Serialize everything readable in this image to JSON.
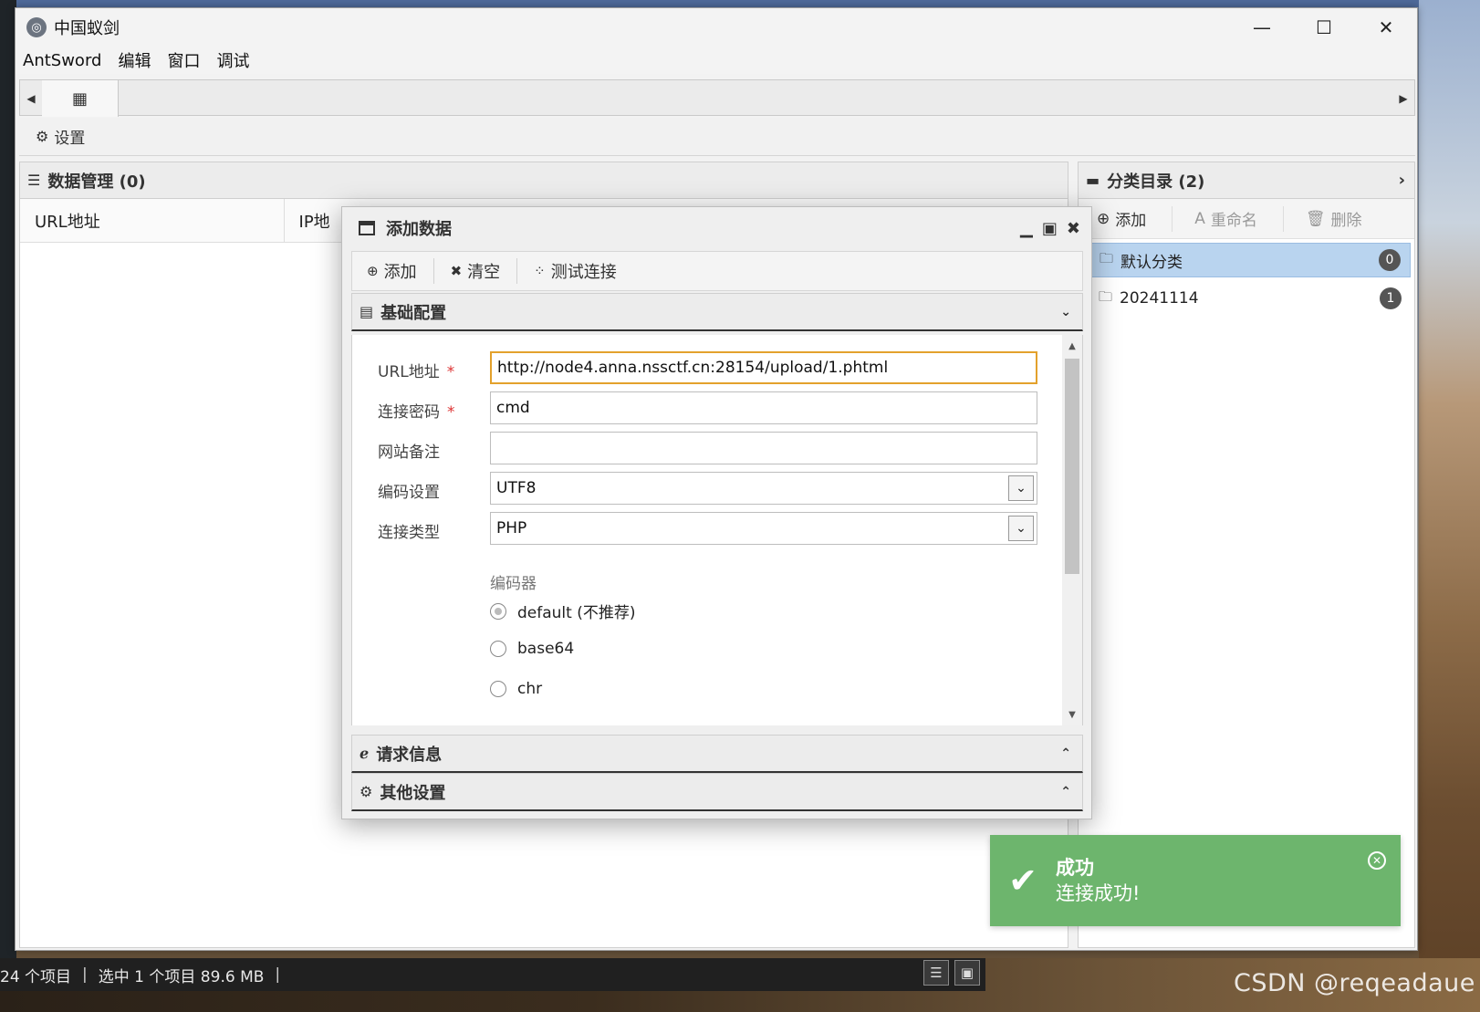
{
  "window": {
    "title": "中国蚁剑",
    "minimize": "—",
    "maximize": "☐",
    "close": "✕"
  },
  "menu": [
    "AntSword",
    "编辑",
    "窗口",
    "调试"
  ],
  "tabs": {
    "left_arrow": "◀",
    "right_arrow": "▶",
    "home_icon": "▦"
  },
  "settings_toolbar": {
    "label": "设置"
  },
  "data_panel": {
    "header": "数据管理 (0)",
    "columns": [
      "URL地址",
      "IP地"
    ]
  },
  "category_panel": {
    "header": "分类目录 (2)",
    "buttons": {
      "add": "添加",
      "rename": "重命名",
      "delete": "删除"
    },
    "items": [
      {
        "label": "默认分类",
        "count": "0",
        "selected": true
      },
      {
        "label": "20241114",
        "count": "1",
        "selected": false
      }
    ]
  },
  "dialog": {
    "title": "添加数据",
    "toolbar": {
      "add": "添加",
      "clear": "清空",
      "test": "测试连接"
    },
    "section_basic": "基础配置",
    "section_request": "请求信息",
    "section_other": "其他设置",
    "fields": {
      "url_label": "URL地址",
      "url_value": "http://node4.anna.nssctf.cn:28154/upload/1.phtml",
      "password_label": "连接密码",
      "password_value": "cmd",
      "note_label": "网站备注",
      "note_value": "",
      "encoding_label": "编码设置",
      "encoding_value": "UTF8",
      "type_label": "连接类型",
      "type_value": "PHP",
      "required_mark": "*"
    },
    "encoder": {
      "title": "编码器",
      "options": [
        "default (不推荐)",
        "base64",
        "chr"
      ],
      "selected": "default (不推荐)"
    }
  },
  "toast": {
    "title": "成功",
    "message": "连接成功!",
    "color": "#6db56d"
  },
  "statusbar": {
    "items": "24 个项目",
    "selected": "选中 1 个项目  89.6 MB"
  },
  "watermark": "CSDN @reqeadaue"
}
